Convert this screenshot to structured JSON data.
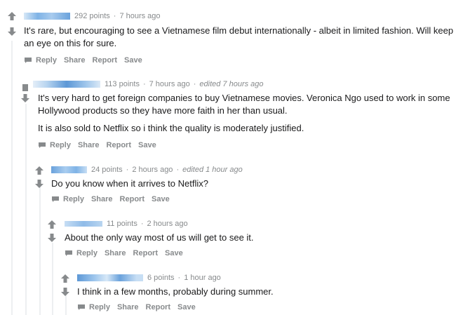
{
  "comments": [
    {
      "points": "292 points",
      "time": "7 hours ago",
      "edited": "",
      "paragraphs": [
        "It's rare, but encouraging to see a Vietnamese film debut internationally - albeit in limited fashion. Will keep an eye on this for sure."
      ],
      "actions": {
        "reply": "Reply",
        "share": "Share",
        "report": "Report",
        "save": "Save"
      }
    },
    {
      "points": "113 points",
      "time": "7 hours ago",
      "edited": "edited 7 hours ago",
      "paragraphs": [
        "It's very hard to get foreign companies to buy Vietnamese movies. Veronica Ngo used to work in some Hollywood products so they have more faith in her than usual.",
        "It is also sold to Netflix so i think the quality is moderately justified."
      ],
      "actions": {
        "reply": "Reply",
        "share": "Share",
        "report": "Report",
        "save": "Save"
      }
    },
    {
      "points": "24 points",
      "time": "2 hours ago",
      "edited": "edited 1 hour ago",
      "paragraphs": [
        "Do you know when it arrives to Netflix?"
      ],
      "actions": {
        "reply": "Reply",
        "share": "Share",
        "report": "Report",
        "save": "Save"
      }
    },
    {
      "points": "11 points",
      "time": "2 hours ago",
      "edited": "",
      "paragraphs": [
        "About the only way most of us will get to see it."
      ],
      "actions": {
        "reply": "Reply",
        "share": "Share",
        "report": "Report",
        "save": "Save"
      }
    },
    {
      "points": "6 points",
      "time": "1 hour ago",
      "edited": "",
      "paragraphs": [
        "I think in a few months, probably during summer."
      ],
      "actions": {
        "reply": "Reply",
        "share": "Share",
        "report": "Report",
        "save": "Save"
      }
    }
  ],
  "icons": {
    "upvote": "upvote-arrow-icon",
    "downvote": "downvote-arrow-icon",
    "reply": "chat-bubble-icon"
  },
  "colors": {
    "arrow": "#878a8c",
    "meta": "#878a8c",
    "username_blur": "#7fb3e6",
    "thread_line": "#edeff1"
  }
}
